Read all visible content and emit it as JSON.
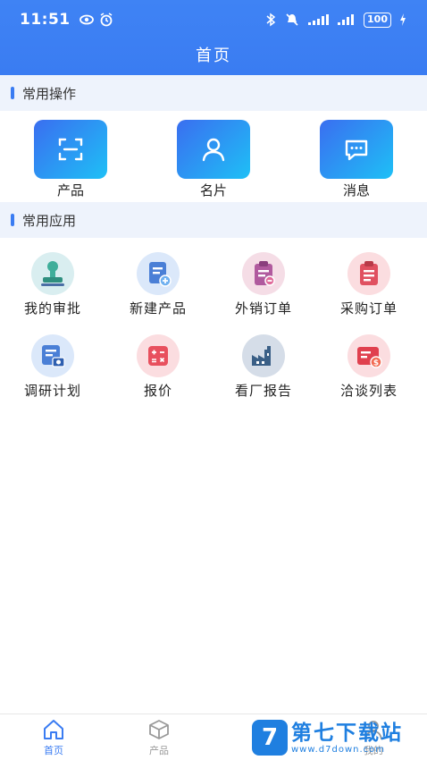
{
  "status_bar": {
    "time": "11:51",
    "battery": "100"
  },
  "header": {
    "title": "首页"
  },
  "sections": {
    "quick": "常用操作",
    "apps": "常用应用"
  },
  "quick_actions": [
    {
      "label": "产品",
      "icon": "scan-icon"
    },
    {
      "label": "名片",
      "icon": "person-icon"
    },
    {
      "label": "消息",
      "icon": "message-icon"
    }
  ],
  "apps": [
    {
      "label": "我的审批",
      "icon": "stamp-icon"
    },
    {
      "label": "新建产品",
      "icon": "new-doc-icon"
    },
    {
      "label": "外销订单",
      "icon": "clipboard-icon"
    },
    {
      "label": "采购订单",
      "icon": "purchase-icon"
    },
    {
      "label": "调研计划",
      "icon": "research-icon"
    },
    {
      "label": "报价",
      "icon": "calculator-icon"
    },
    {
      "label": "看厂报告",
      "icon": "factory-icon"
    },
    {
      "label": "洽谈列表",
      "icon": "money-list-icon"
    }
  ],
  "tabbar": [
    {
      "label": "首页",
      "icon": "home-icon"
    },
    {
      "label": "产品",
      "icon": "cube-icon"
    },
    {
      "label": "我的",
      "icon": "user-icon"
    }
  ],
  "watermark": {
    "logo": "7",
    "main": "第七下载站",
    "sub": "www.d7down.com"
  },
  "colors": {
    "primary": "#3a7cf2",
    "section_bg": "#eef3fc"
  }
}
